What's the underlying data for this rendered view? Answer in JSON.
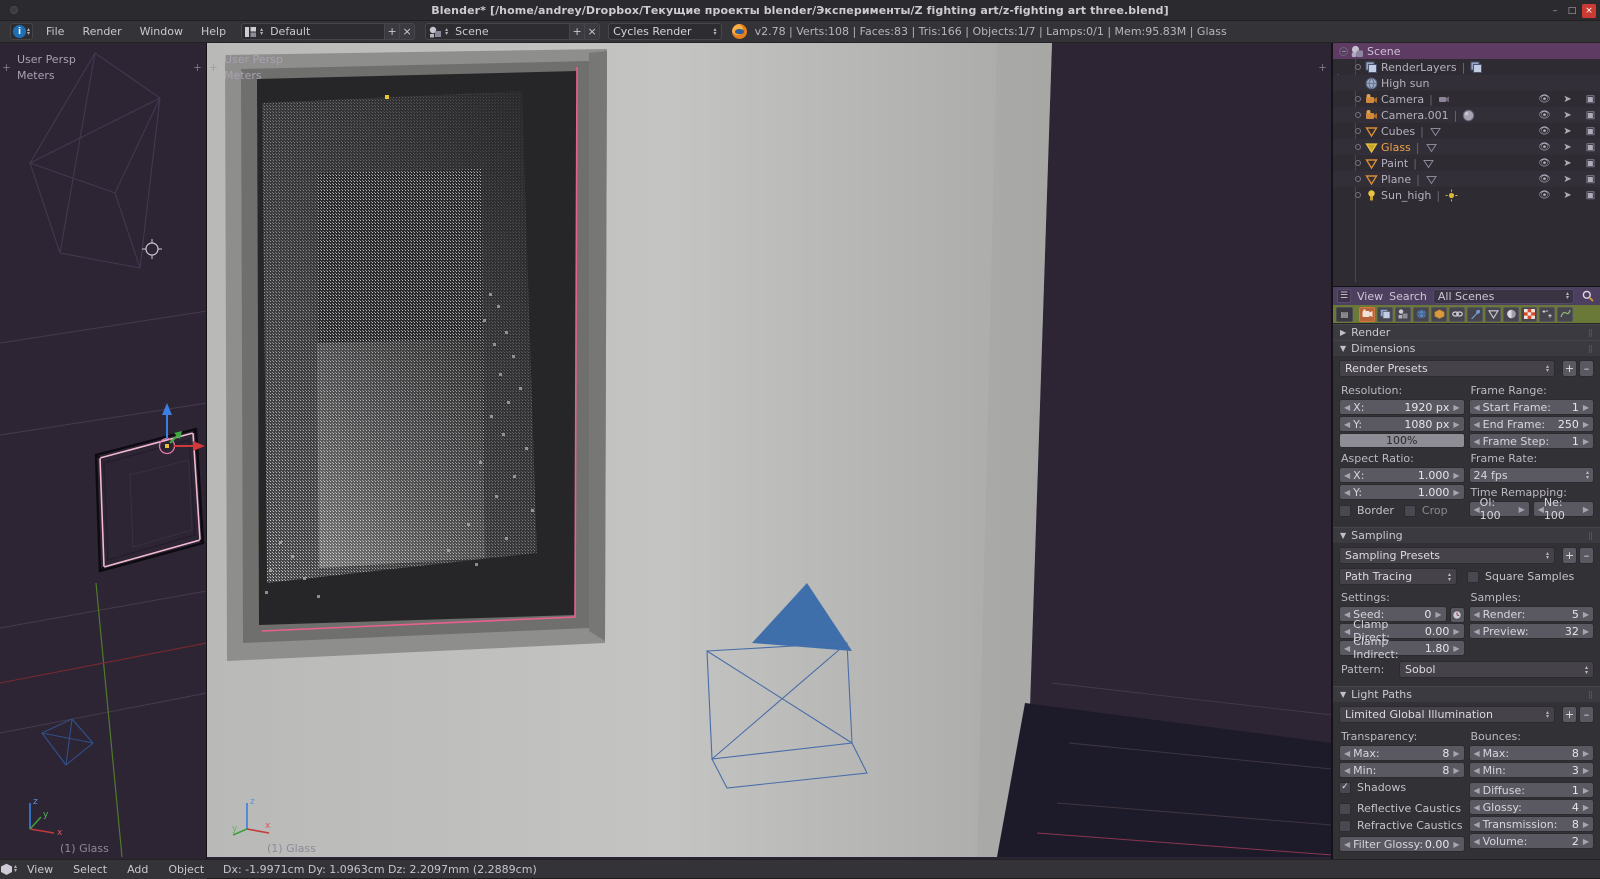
{
  "window": {
    "title": "Blender* [/home/andrey/Dropbox/Текущие проекты blender/Эксперименты/Z fighting art/z-fighting art three.blend]",
    "minimize": "–",
    "maximize": "□",
    "close": "×"
  },
  "topbar": {
    "editor_icon": "info-editor-icon",
    "menus": [
      "File",
      "Render",
      "Window",
      "Help"
    ],
    "screen_layout": "Default",
    "screen_add": "+",
    "screen_remove": "×",
    "scene_name": "Scene",
    "scene_add": "+",
    "scene_remove": "×",
    "engine": "Cycles Render",
    "stats": "v2.78 | Verts:108 | Faces:83 | Tris:166 | Objects:1/7 | Lamps:0/1 | Mem:95.83M | Glass"
  },
  "viewports": [
    {
      "persp": "User Persp",
      "units": "Meters",
      "object": "(1) Glass"
    },
    {
      "persp": "User Persp",
      "units": "Meters",
      "object": "(1) Glass"
    }
  ],
  "axis_labels": {
    "x": "x",
    "y": "y",
    "z": "z"
  },
  "outliner": {
    "rows": [
      {
        "label": "Scene",
        "indent": 0,
        "icon": "scene-icon",
        "selected": true,
        "expand": "collapse",
        "has_cols": false,
        "secondary": ""
      },
      {
        "label": "RenderLayers",
        "indent": 1,
        "icon": "renderlayers-icon",
        "selected": false,
        "expand": "dot",
        "has_cols": false,
        "secondary": "renderlayer-data-icon"
      },
      {
        "label": "High sun",
        "indent": 2,
        "icon": "world-icon",
        "selected": false,
        "expand": "none",
        "has_cols": false,
        "secondary": ""
      },
      {
        "label": "Camera",
        "indent": 1,
        "icon": "camera-icon",
        "selected": false,
        "expand": "dot",
        "has_cols": true,
        "secondary": "camera-data-icon"
      },
      {
        "label": "Camera.001",
        "indent": 1,
        "icon": "camera-icon",
        "selected": false,
        "expand": "dot",
        "has_cols": true,
        "secondary": "sphere-data-icon"
      },
      {
        "label": "Cubes",
        "indent": 1,
        "icon": "mesh-icon",
        "selected": false,
        "expand": "dot",
        "has_cols": true,
        "secondary": "mesh-data-icon"
      },
      {
        "label": "Glass",
        "indent": 1,
        "icon": "mesh-icon-active",
        "selected": false,
        "expand": "dot",
        "has_cols": true,
        "secondary": "mesh-data-icon",
        "active": true
      },
      {
        "label": "Paint",
        "indent": 1,
        "icon": "mesh-icon",
        "selected": false,
        "expand": "dot",
        "has_cols": true,
        "secondary": "mesh-data-icon"
      },
      {
        "label": "Plane",
        "indent": 1,
        "icon": "mesh-icon",
        "selected": false,
        "expand": "dot",
        "has_cols": true,
        "secondary": "mesh-data-icon"
      },
      {
        "label": "Sun_high",
        "indent": 1,
        "icon": "lamp-icon",
        "selected": false,
        "expand": "dot",
        "has_cols": true,
        "secondary": "sun-data-icon"
      }
    ],
    "col_icons": [
      "eye-icon",
      "cursor-arrow-icon",
      "camera-restrict-icon"
    ]
  },
  "properties": {
    "header": {
      "view": "View",
      "search": "Search",
      "scope": "All Scenes",
      "search_icon": "magnifier-icon"
    },
    "tabs": [
      {
        "name": "render-tab",
        "icon": "camera-back-icon",
        "active": true
      },
      {
        "name": "render-layers-tab",
        "icon": "images-icon",
        "active": false
      },
      {
        "name": "scene-tab",
        "icon": "scene-cone-icon",
        "active": false
      },
      {
        "name": "world-tab",
        "icon": "globe-icon",
        "active": false
      },
      {
        "name": "object-tab",
        "icon": "cube-icon",
        "active": false
      },
      {
        "name": "constraints-tab",
        "icon": "chain-icon",
        "active": false
      },
      {
        "name": "modifiers-tab",
        "icon": "wrench-icon",
        "active": false
      },
      {
        "name": "data-tab",
        "icon": "triangle-mesh-icon",
        "active": false
      },
      {
        "name": "material-tab",
        "icon": "sphere-icon",
        "active": false
      },
      {
        "name": "texture-tab",
        "icon": "checker-icon",
        "active": false
      },
      {
        "name": "particles-tab",
        "icon": "particles-icon",
        "active": false
      },
      {
        "name": "physics-tab",
        "icon": "physics-icon",
        "active": false
      }
    ],
    "panels": {
      "render": {
        "title": "Render",
        "open": false
      },
      "dimensions": {
        "title": "Dimensions",
        "open": true,
        "preset": "Render Presets",
        "preset_add": "+",
        "preset_remove": "–",
        "resolution_label": "Resolution:",
        "res_x_label": "X:",
        "res_x_value": "1920 px",
        "res_y_label": "Y:",
        "res_y_value": "1080 px",
        "res_percent": "100%",
        "aspect_label": "Aspect Ratio:",
        "aspect_x_label": "X:",
        "aspect_x_value": "1.000",
        "aspect_y_label": "Y:",
        "aspect_y_value": "1.000",
        "border_label": "Border",
        "border_checked": false,
        "crop_label": "Crop",
        "crop_checked": false,
        "frame_range_label": "Frame Range:",
        "start_frame_label": "Start Frame:",
        "start_frame_value": "1",
        "end_frame_label": "End Frame:",
        "end_frame_value": "250",
        "frame_step_label": "Frame Step:",
        "frame_step_value": "1",
        "frame_rate_label": "Frame Rate:",
        "frame_rate_value": "24 fps",
        "time_remap_label": "Time Remapping:",
        "old_label": "Ol: 100",
        "new_label": "Ne: 100"
      },
      "sampling": {
        "title": "Sampling",
        "open": true,
        "preset": "Sampling Presets",
        "preset_add": "+",
        "preset_remove": "–",
        "integrator": "Path Tracing",
        "square_samples_label": "Square Samples",
        "square_samples_checked": false,
        "settings_label": "Settings:",
        "seed_label": "Seed:",
        "seed_value": "0",
        "seed_anim_icon": "clock-icon",
        "clamp_direct_label": "Clamp Direct:",
        "clamp_direct_value": "0.00",
        "clamp_indirect_label": "Clamp Indirect:",
        "clamp_indirect_value": "1.80",
        "samples_label": "Samples:",
        "render_label": "Render:",
        "render_value": "5",
        "preview_label": "Preview:",
        "preview_value": "32",
        "pattern_label": "Pattern:",
        "pattern_value": "Sobol"
      },
      "light_paths": {
        "title": "Light Paths",
        "open": true,
        "preset": "Limited Global Illumination",
        "preset_add": "+",
        "preset_remove": "–",
        "transparency_label": "Transparency:",
        "t_max_label": "Max:",
        "t_max_value": "8",
        "t_min_label": "Min:",
        "t_min_value": "8",
        "shadows_label": "Shadows",
        "shadows_checked": true,
        "reflective_caustics_label": "Reflective Caustics",
        "reflective_caustics_checked": false,
        "refractive_caustics_label": "Refractive Caustics",
        "refractive_caustics_checked": false,
        "filter_glossy_label": "Filter Glossy:",
        "filter_glossy_value": "0.00",
        "bounces_label": "Bounces:",
        "b_max_label": "Max:",
        "b_max_value": "8",
        "b_min_label": "Min:",
        "b_min_value": "3",
        "diffuse_label": "Diffuse:",
        "diffuse_value": "1",
        "glossy_label": "Glossy:",
        "glossy_value": "4",
        "transmission_label": "Transmission:",
        "transmission_value": "8",
        "volume_label": "Volume:",
        "volume_value": "2"
      }
    }
  },
  "statusbar": {
    "mode_icon": "object-mode-icon",
    "menus": [
      "View",
      "Select",
      "Add",
      "Object"
    ],
    "delta_info": "Dx: -1.9971cm  Dy: 1.0963cm  Dz: 2.2097mm (2.2889cm)"
  },
  "colors": {
    "accent_orange": "#f0a24a",
    "selected_row": "#5d3b63",
    "tabbar_green": "#6a7838",
    "active_tab": "#b5643a",
    "viewport_purple": "#2d2434",
    "selection_pink": "#e8608f"
  }
}
